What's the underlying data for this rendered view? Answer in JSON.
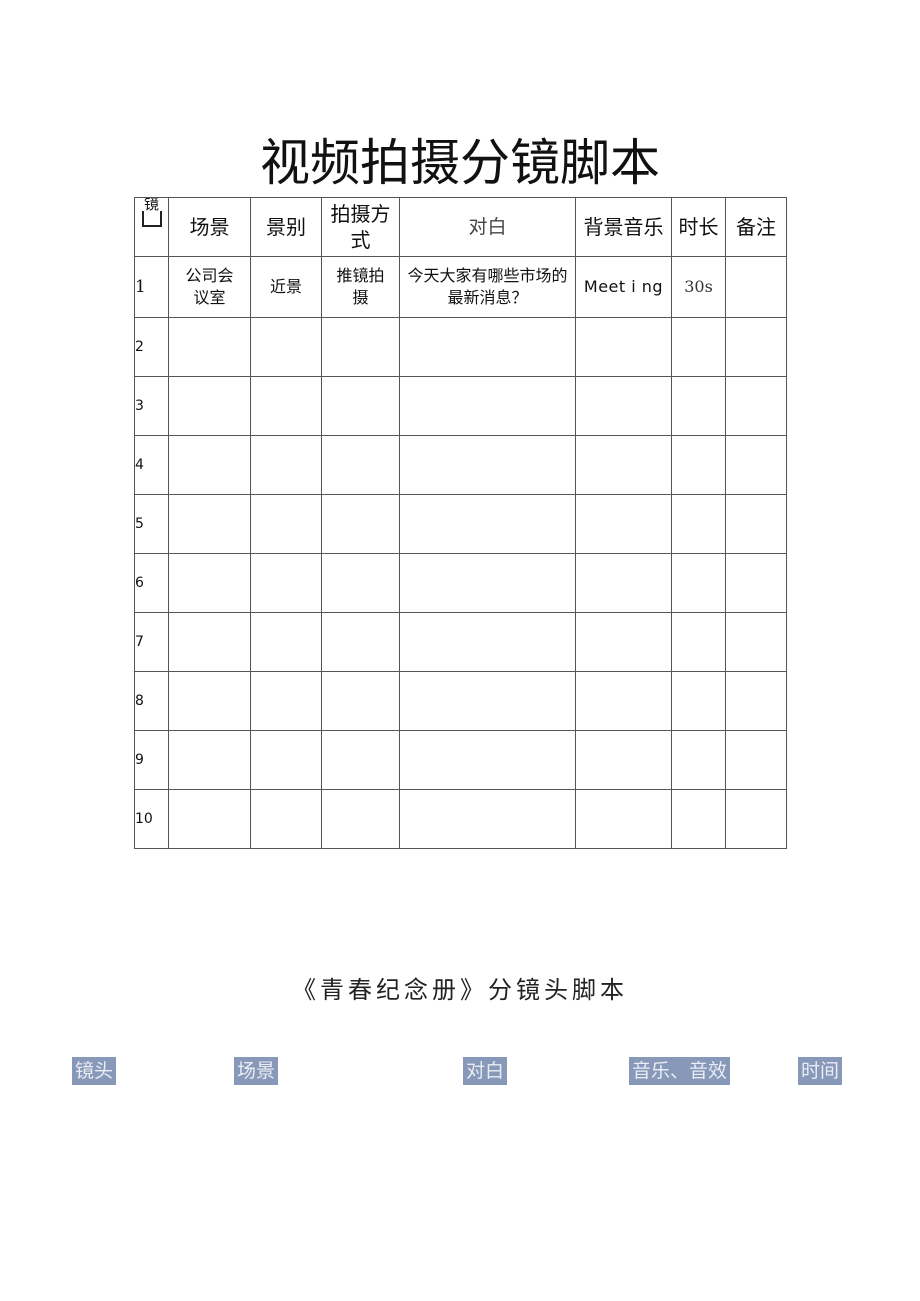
{
  "document": {
    "title": "视频拍摄分镜脚本",
    "table": {
      "headers": {
        "shot": "镜",
        "scene": "场景",
        "shot_size": "景别",
        "camera_method": "拍摄方式",
        "dialogue": "对白",
        "bgm": "背景音乐",
        "duration": "时长",
        "notes": "备注"
      },
      "rows": [
        {
          "no": "1",
          "scene": "公司会议室",
          "shot_size": "近景",
          "camera_method": "推镜拍摄",
          "dialogue": "今天大家有哪些市场的最新消息？",
          "bgm": "Meet i ng",
          "duration": "30s",
          "notes": ""
        },
        {
          "no": "2",
          "scene": "",
          "shot_size": "",
          "camera_method": "",
          "dialogue": "",
          "bgm": "",
          "duration": "",
          "notes": ""
        },
        {
          "no": "3",
          "scene": "",
          "shot_size": "",
          "camera_method": "",
          "dialogue": "",
          "bgm": "",
          "duration": "",
          "notes": ""
        },
        {
          "no": "4",
          "scene": "",
          "shot_size": "",
          "camera_method": "",
          "dialogue": "",
          "bgm": "",
          "duration": "",
          "notes": ""
        },
        {
          "no": "5",
          "scene": "",
          "shot_size": "",
          "camera_method": "",
          "dialogue": "",
          "bgm": "",
          "duration": "",
          "notes": ""
        },
        {
          "no": "6",
          "scene": "",
          "shot_size": "",
          "camera_method": "",
          "dialogue": "",
          "bgm": "",
          "duration": "",
          "notes": ""
        },
        {
          "no": "7",
          "scene": "",
          "shot_size": "",
          "camera_method": "",
          "dialogue": "",
          "bgm": "",
          "duration": "",
          "notes": ""
        },
        {
          "no": "8",
          "scene": "",
          "shot_size": "",
          "camera_method": "",
          "dialogue": "",
          "bgm": "",
          "duration": "",
          "notes": ""
        },
        {
          "no": "9",
          "scene": "",
          "shot_size": "",
          "camera_method": "",
          "dialogue": "",
          "bgm": "",
          "duration": "",
          "notes": ""
        },
        {
          "no": "10",
          "scene": "",
          "shot_size": "",
          "camera_method": "",
          "dialogue": "",
          "bgm": "",
          "duration": "",
          "notes": ""
        }
      ]
    },
    "subtitle": "《青春纪念册》分镜头脚本",
    "tags": [
      {
        "label": "镜头"
      },
      {
        "label": "场景"
      },
      {
        "label": "对白"
      },
      {
        "label": "音乐、音效"
      },
      {
        "label": "时间"
      }
    ],
    "colors": {
      "tag_background": "#8898b8",
      "tag_text": "#e9edf5",
      "border": "#555555"
    }
  }
}
